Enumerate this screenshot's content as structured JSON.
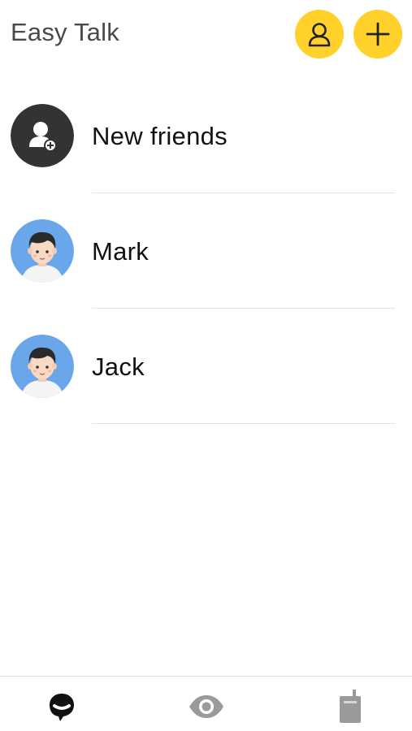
{
  "header": {
    "title": "Easy Talk",
    "contacts_icon": "person-outline-icon",
    "add_icon": "plus-icon",
    "accent": "#ffd12a"
  },
  "list": {
    "items": [
      {
        "label": "New friends",
        "icon": "add-friend-icon"
      },
      {
        "label": "Mark",
        "icon": "male-avatar"
      },
      {
        "label": "Jack",
        "icon": "male-avatar"
      }
    ]
  },
  "bottom_nav": {
    "items": [
      {
        "icon": "chat-bubble-icon",
        "active": true
      },
      {
        "icon": "eye-icon",
        "active": false
      },
      {
        "icon": "walkie-talkie-icon",
        "active": false
      }
    ]
  }
}
